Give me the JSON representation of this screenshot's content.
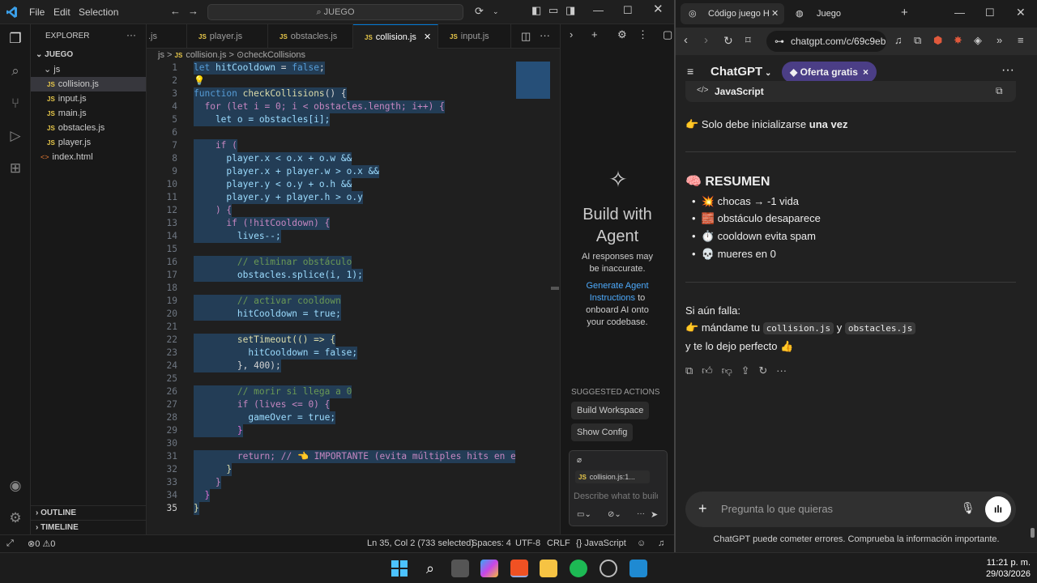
{
  "vscode": {
    "menu": [
      "File",
      "Edit",
      "Selection"
    ],
    "search_text": "JUEGO",
    "explorer": {
      "title": "EXPLORER",
      "root": "JUEGO",
      "folder": "js",
      "files": [
        "collision.js",
        "input.js",
        "main.js",
        "obstacles.js",
        "player.js"
      ],
      "index_file": "index.html",
      "outline": "OUTLINE",
      "timeline": "TIMELINE"
    },
    "tabs": [
      ".js",
      "player.js",
      "obstacles.js",
      "collision.js",
      "input.js"
    ],
    "breadcrumb": {
      "folder": "js",
      "sep": ">",
      "file": "collision.js",
      "symbol": "checkCollisions"
    },
    "line_numbers": [
      "1",
      "2",
      "3",
      "4",
      "5",
      "6",
      "7",
      "8",
      "9",
      "10",
      "11",
      "12",
      "13",
      "14",
      "15",
      "16",
      "17",
      "18",
      "19",
      "20",
      "21",
      "22",
      "23",
      "24",
      "25",
      "26",
      "27",
      "28",
      "29",
      "30",
      "31",
      "32",
      "33",
      "34",
      "35"
    ],
    "code": {
      "l1": {
        "kw": "let",
        "name": "hitCooldown",
        "rest": " = ",
        "val": "false",
        "end": ";"
      },
      "l3": {
        "kw": "function",
        "name": "checkCollisions",
        "rest": "() {"
      },
      "l4": "  for (let i = 0; i < obstacles.length; i++) {",
      "l5": "    let o = obstacles[i];",
      "l7": "    if (",
      "l8": "      player.x < o.x + o.w &&",
      "l9": "      player.x + player.w > o.x &&",
      "l10": "      player.y < o.y + o.h &&",
      "l11": "      player.y + player.h > o.y",
      "l12": "    ) {",
      "l13": "      if (!hitCooldown) {",
      "l14": "        lives--;",
      "l16": "        // eliminar obstáculo",
      "l17": "        obstacles.splice(i, 1);",
      "l19": "        // activar cooldown",
      "l20": "        hitCooldown = true;",
      "l22": "        setTimeout(() => {",
      "l23": "          hitCooldown = false;",
      "l24": "        }, 400);",
      "l26": "        // morir si llega a 0",
      "l27": "        if (lives <= 0) {",
      "l28": "          gameOver = true;",
      "l29": "        }",
      "l31": "        return; // 👈 IMPORTANTE (evita múltiples hits en el",
      "l32": "      }",
      "l33": "    }",
      "l34": "  }",
      "l35": "}"
    },
    "agent": {
      "title1": "Build with",
      "title2": "Agent",
      "disclaimer": "AI responses may be inaccurate.",
      "link": "Generate Agent Instructions",
      "link_rest": "to onboard AI onto your codebase.",
      "suggested": "SUGGESTED ACTIONS",
      "btn1": "Build Workspace",
      "btn2": "Show Config",
      "context_file": "collision.js:1...",
      "input_placeholder": "Describe what to build"
    },
    "status": {
      "errors": "0",
      "warnings": "0",
      "position": "Ln 35, Col 2 (733 selected)",
      "spaces": "Spaces: 4",
      "encoding": "UTF-8",
      "eol": "CRLF",
      "language": "JavaScript"
    }
  },
  "browser": {
    "tab_active": "Código juego H",
    "tab_other": "Juego",
    "url": "chatgpt.com/c/69c9eb",
    "app_name": "ChatGPT",
    "offer": "Oferta gratis",
    "code_lang": "JavaScript",
    "line_once_pre": "Solo debe inicializarse ",
    "line_once_bold": "una vez",
    "summary_title": "RESUMEN",
    "summary": [
      {
        "emoji": "💥",
        "text": "chocas → -1 vida"
      },
      {
        "emoji": "🧱",
        "text": "obstáculo desaparece"
      },
      {
        "emoji": "⏱️",
        "text": "cooldown evita spam"
      },
      {
        "emoji": "💀",
        "text": "mueres en 0"
      }
    ],
    "fail_line": "Si aún falla:",
    "send_pre": "mándame tu ",
    "file1": "collision.js",
    "send_mid": " y ",
    "file2": "obstacles.js",
    "final_line": "y te lo dejo perfecto 👍",
    "composer_placeholder": "Pregunta lo que quieras",
    "footer": "ChatGPT puede cometer errores. Comprueba la información importante."
  },
  "taskbar": {
    "time": "11:21 p. m.",
    "date": "29/03/2026"
  }
}
